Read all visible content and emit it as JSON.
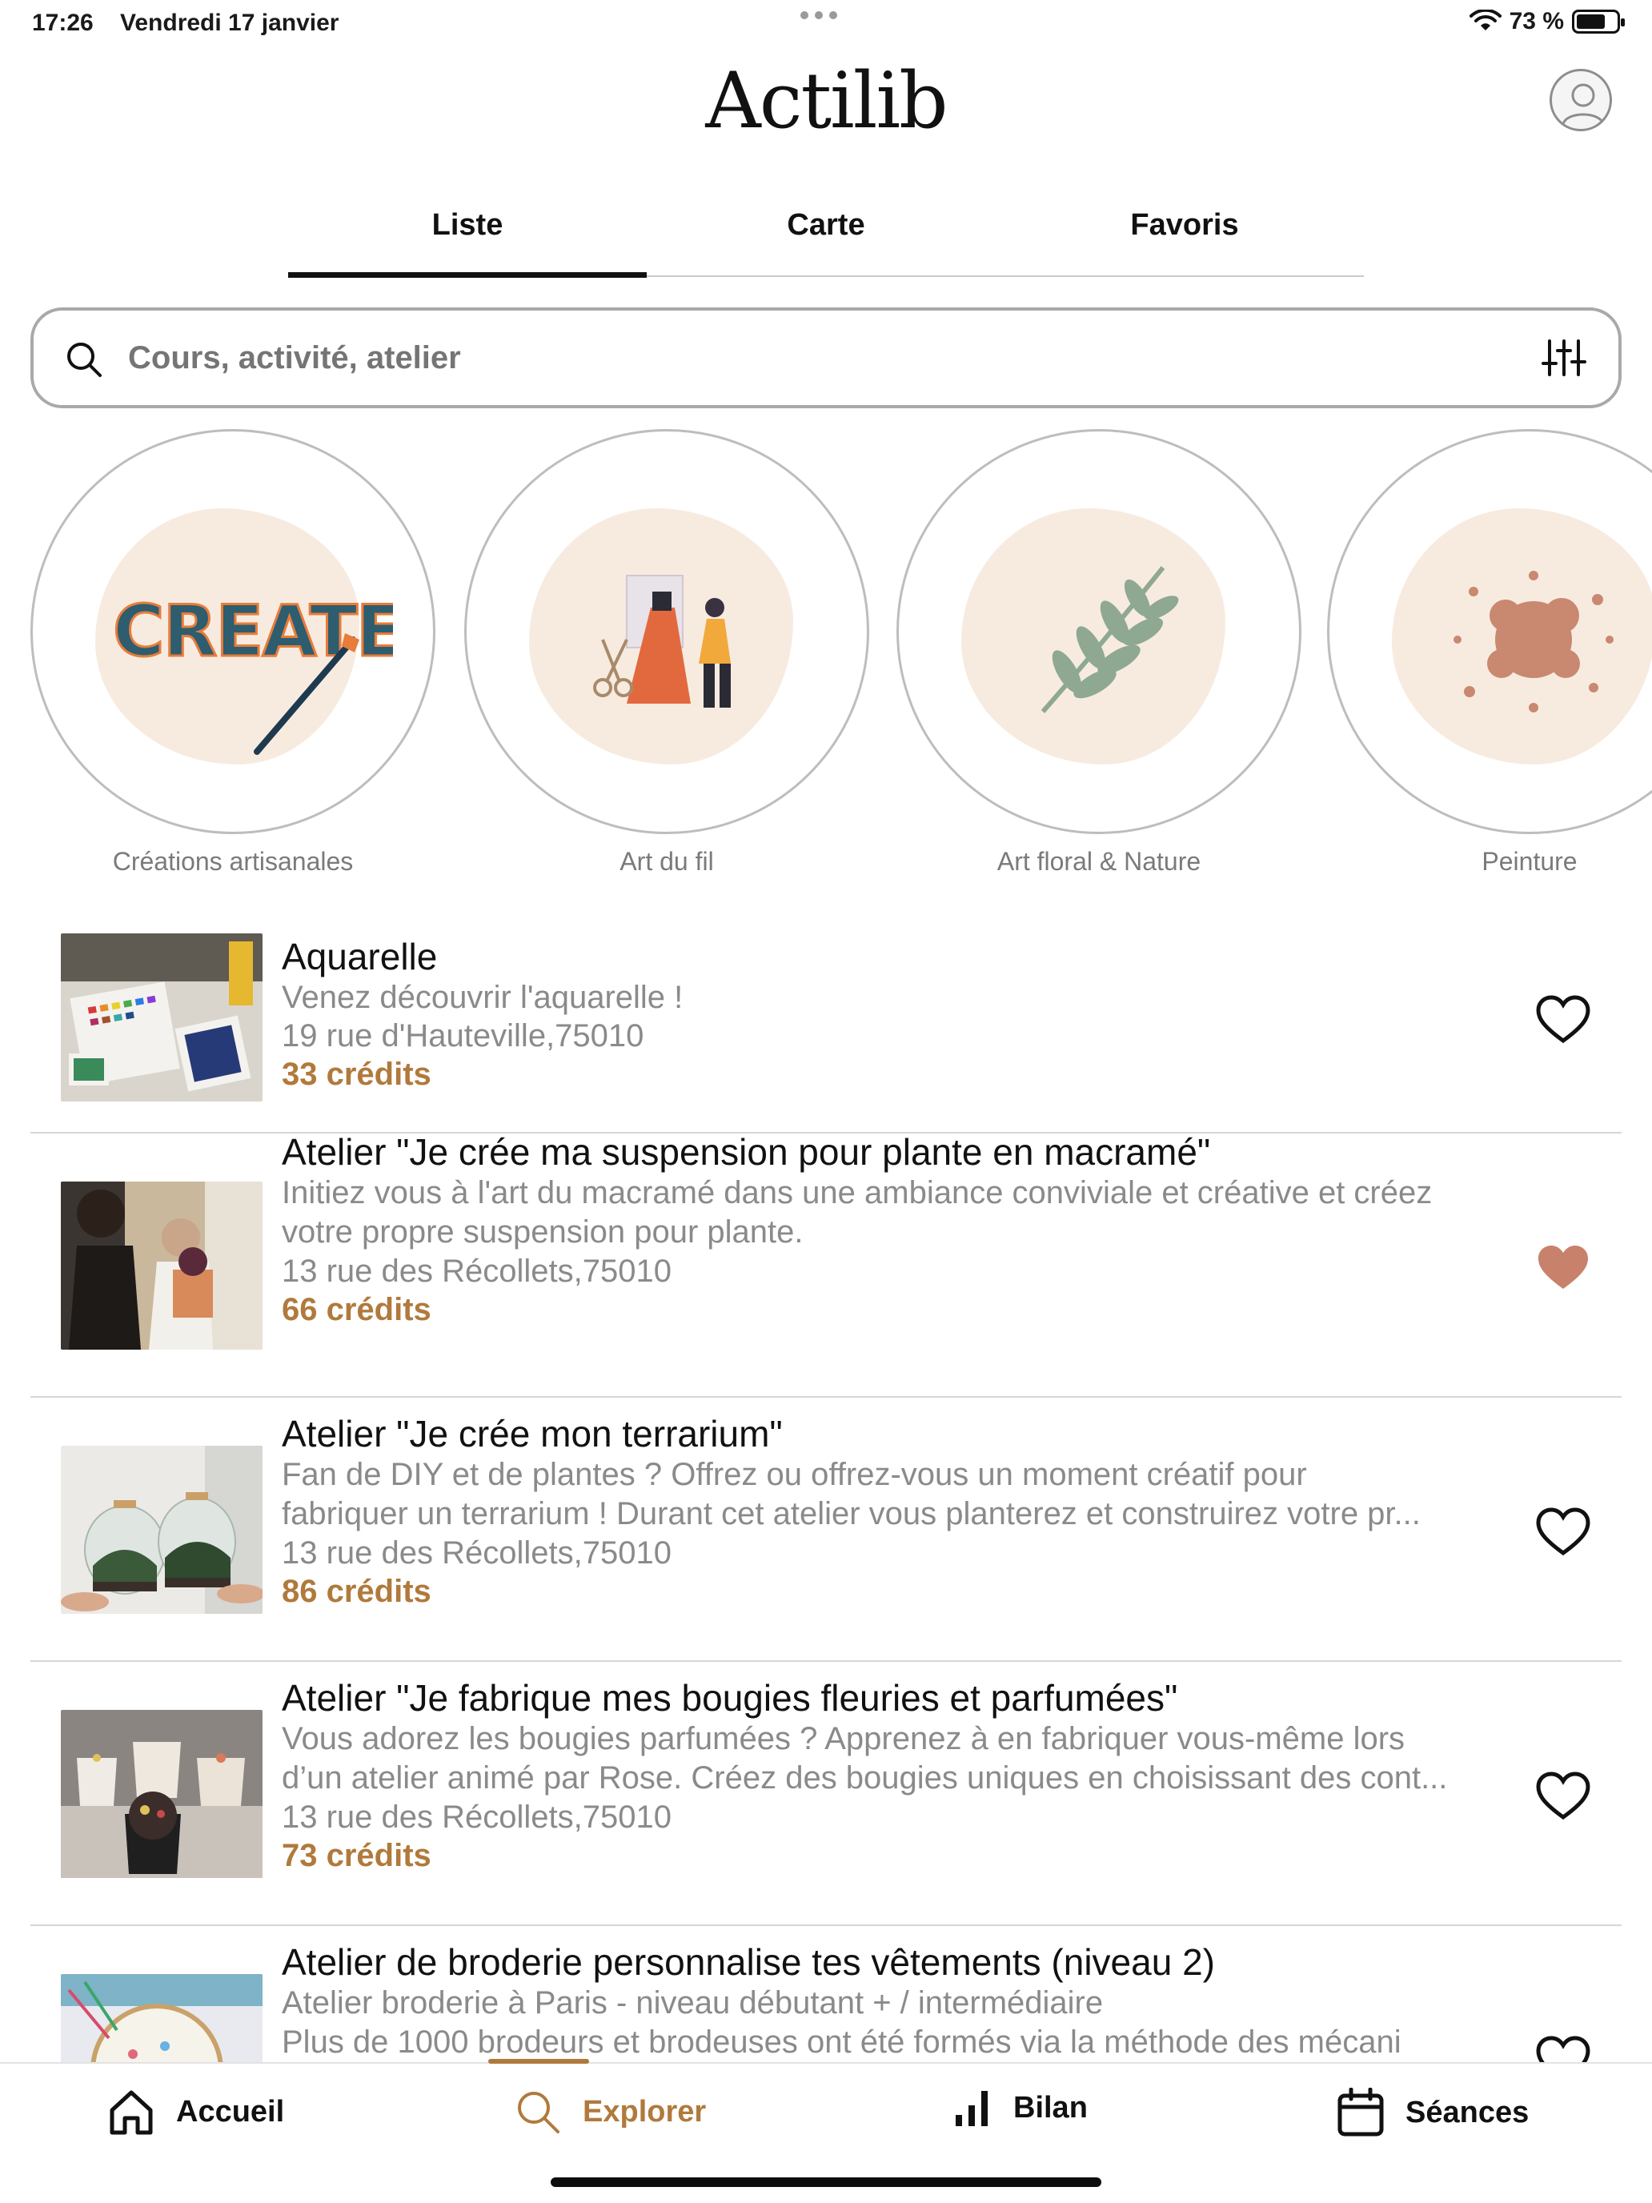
{
  "status_bar": {
    "time": "17:26",
    "date": "Vendredi 17 janvier",
    "battery_text": "73 %",
    "battery_level": 0.73
  },
  "header": {
    "logo_text": "Actilib",
    "avatar_icon": "user-avatar-icon"
  },
  "tabs": [
    {
      "label": "Liste",
      "active": true
    },
    {
      "label": "Carte",
      "active": false
    },
    {
      "label": "Favoris",
      "active": false
    }
  ],
  "search": {
    "placeholder": "Cours, activité, atelier",
    "value": "",
    "icon": "search-icon",
    "filter_icon": "sliders-icon"
  },
  "categories": [
    {
      "label": "Créations artisanales",
      "icon": "create-brush-icon"
    },
    {
      "label": "Art du fil",
      "icon": "sewing-mannequin-icon"
    },
    {
      "label": "Art floral & Nature",
      "icon": "leaf-branch-icon"
    },
    {
      "label": "Peinture",
      "icon": "paint-splash-icon"
    }
  ],
  "activities": [
    {
      "title": "Aquarelle",
      "desc_lines": [
        "Venez découvrir l'aquarelle !"
      ],
      "address": "19 rue d'Hauteville,75010",
      "credits": "33 crédits",
      "favorite": false
    },
    {
      "title": "Atelier \"Je crée ma suspension pour plante en macramé\"",
      "desc_lines": [
        "Initiez vous à l'art du macramé dans une ambiance conviviale et créative et créez",
        "votre propre suspension pour plante."
      ],
      "address": "13 rue des Récollets,75010",
      "credits": "66 crédits",
      "favorite": true
    },
    {
      "title": "Atelier \"Je crée mon terrarium\"",
      "desc_lines": [
        "Fan de DIY et de plantes ? Offrez ou offrez-vous un moment créatif pour",
        "fabriquer un terrarium ! Durant cet atelier vous planterez et construirez votre pr..."
      ],
      "address": "13 rue des Récollets,75010",
      "credits": "86 crédits",
      "favorite": false
    },
    {
      "title": "Atelier \"Je fabrique mes bougies fleuries et parfumées\"",
      "desc_lines": [
        "Vous adorez les bougies parfumées ? Apprenez à en fabriquer vous-même lors",
        "d’un atelier animé par Rose. Créez des bougies uniques en choisissant des cont..."
      ],
      "address": "13 rue des Récollets,75010",
      "credits": "73 crédits",
      "favorite": false
    },
    {
      "title": "Atelier de broderie personnalise tes vêtements (niveau 2)",
      "desc_lines": [
        "Atelier broderie à Paris - niveau débutant + / intermédiaire",
        "Plus de 1000 brodeurs et brodeuses ont été formés via la méthode des mécani"
      ],
      "address": "",
      "credits": "",
      "favorite": false
    }
  ],
  "bottom_nav": [
    {
      "label": "Accueil",
      "icon": "home-icon",
      "active": false
    },
    {
      "label": "Explorer",
      "icon": "search-icon",
      "active": true
    },
    {
      "label": "Bilan",
      "icon": "bar-chart-icon",
      "active": false
    },
    {
      "label": "Séances",
      "icon": "calendar-icon",
      "active": false
    }
  ],
  "colors": {
    "accent": "#b07a3c",
    "favorite_heart": "#c8816a",
    "category_blob": "#f7ebe0",
    "muted_text": "#8a8a8a"
  }
}
